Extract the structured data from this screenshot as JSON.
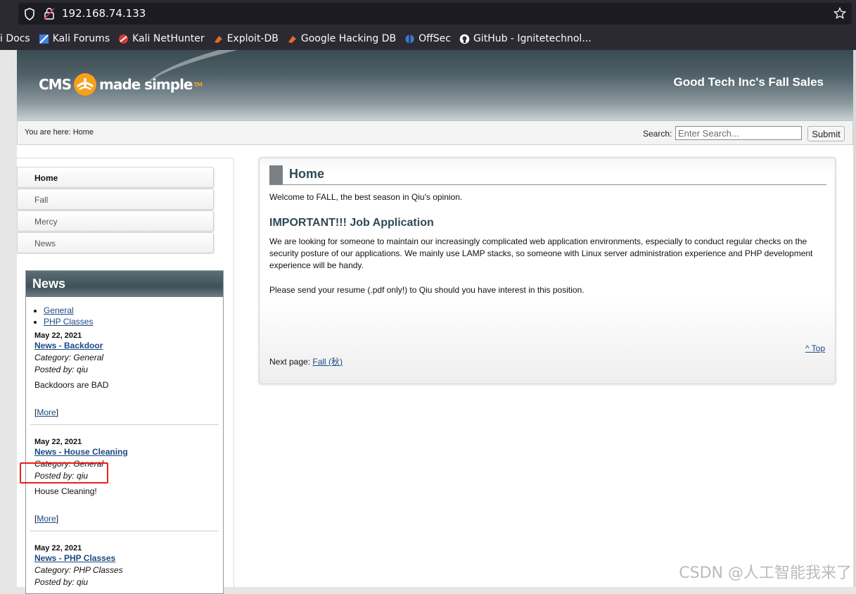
{
  "browser": {
    "url": "192.168.74.133",
    "bookmarks": [
      {
        "label": "i Docs",
        "icon": "none"
      },
      {
        "label": "Kali Forums",
        "icon": "kali-icon"
      },
      {
        "label": "Kali NetHunter",
        "icon": "nethunter-icon"
      },
      {
        "label": "Exploit-DB",
        "icon": "exploitdb-icon"
      },
      {
        "label": "Google Hacking DB",
        "icon": "ghdb-icon"
      },
      {
        "label": "OffSec",
        "icon": "offsec-icon"
      },
      {
        "label": "GitHub - Ignitetechnol...",
        "icon": "github-icon"
      }
    ]
  },
  "header": {
    "logo_left": "CMS",
    "logo_right": "made simple",
    "logo_tm": "TM",
    "site_title": "Good Tech Inc's Fall Sales"
  },
  "crumbbar": {
    "breadcrumb": "You are here: Home",
    "search_label": "Search:",
    "search_placeholder": "Enter Search...",
    "submit_label": "Submit"
  },
  "menu": [
    {
      "label": "Home",
      "active": true
    },
    {
      "label": "Fall",
      "active": false
    },
    {
      "label": "Mercy",
      "active": false
    },
    {
      "label": "News",
      "active": false
    }
  ],
  "news": {
    "heading": "News",
    "categories": [
      "General",
      "PHP Classes"
    ],
    "entries": [
      {
        "date": "May 22, 2021",
        "title": "News - Backdoor",
        "category": "Category: General",
        "posted": "Posted by: qiu",
        "summary": "Backdoors are BAD",
        "more": "More"
      },
      {
        "date": "May 22, 2021",
        "title": "News - House Cleaning",
        "category": "Category: General",
        "posted": "Posted by: qiu",
        "summary": "House Cleaning!",
        "more": "More"
      },
      {
        "date": "May 22, 2021",
        "title": "News - PHP Classes",
        "category": "Category: PHP Classes",
        "posted": "Posted by: qiu",
        "summary": "",
        "more": ""
      }
    ]
  },
  "content": {
    "title": "Home",
    "welcome": "Welcome to FALL, the best season in Qiu's opinion.",
    "subtitle": "IMPORTANT!!! Job Application",
    "para1": "We are looking for someone to maintain our increasingly complicated web application environments, especially to conduct regular checks on the security posture of our applications. We mainly use LAMP stacks, so someone with Linux server administration experience and PHP development experience will be handy.",
    "para2": "Please send your resume (.pdf only!) to Qiu should you have interest in this position.",
    "top_link": "^ Top",
    "next_label": "Next page:",
    "next_link": "Fall (秋)"
  },
  "watermark": "CSDN @人工智能我来了",
  "colors": {
    "accent": "#1a4a80",
    "heading": "#2f4958",
    "annotation": "#e8211c"
  }
}
